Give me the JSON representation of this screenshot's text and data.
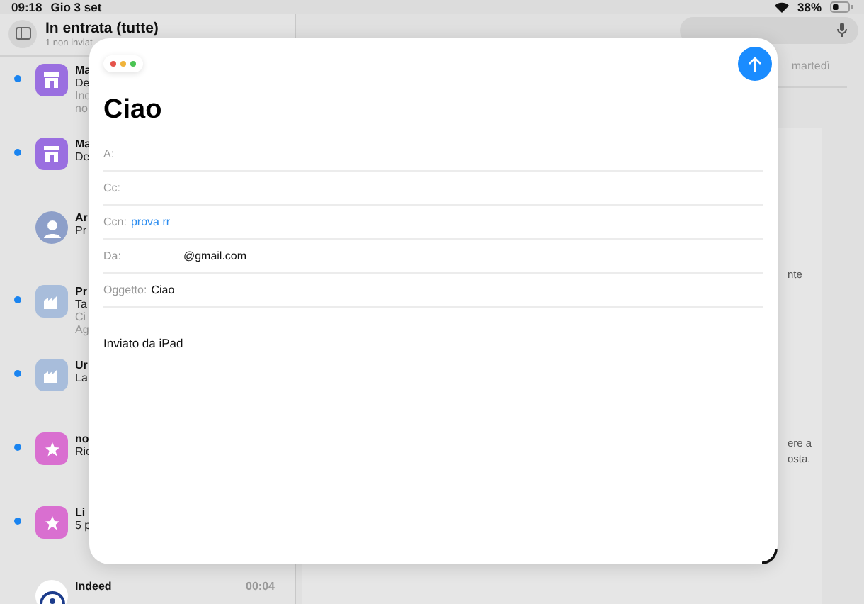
{
  "status_bar": {
    "time": "09:18",
    "date": "Gio 3 set",
    "battery": "38%"
  },
  "mailbox": {
    "title": "In entrata (tutte)",
    "subtitle": "1 non inviat"
  },
  "messages": [
    {
      "kind": "store",
      "unread": true,
      "lines": [
        "Ma",
        "De",
        "Inc",
        "no"
      ]
    },
    {
      "kind": "store",
      "unread": true,
      "lines": [
        "Ma",
        "De"
      ]
    },
    {
      "kind": "person",
      "unread": false,
      "lines": [
        "Ar",
        "Pr"
      ]
    },
    {
      "kind": "building",
      "unread": true,
      "lines": [
        "Pr",
        "Ta",
        "Ci",
        "Ag"
      ]
    },
    {
      "kind": "building",
      "unread": true,
      "lines": [
        "Ur",
        "La"
      ]
    },
    {
      "kind": "star",
      "unread": true,
      "lines": [
        "no",
        "Rie"
      ]
    },
    {
      "kind": "star",
      "unread": true,
      "lines": [
        "Li",
        "5 p"
      ]
    },
    {
      "kind": "logo",
      "unread": false,
      "lines": [
        "Indeed"
      ],
      "time": "00:04"
    }
  ],
  "reader": {
    "date": "martedì",
    "fragments": [
      "nte",
      "ere a",
      "osta."
    ]
  },
  "compose": {
    "title": "Ciao",
    "fields": [
      {
        "label": "A:"
      },
      {
        "label": "Cc:"
      },
      {
        "label": "Ccn:",
        "value": "prova rr",
        "kind": "recipient"
      },
      {
        "label": "Da:",
        "value": "@gmail.com",
        "kind": "account"
      },
      {
        "label": "Oggetto:",
        "value": "Ciao",
        "kind": "text"
      }
    ],
    "body": "Inviato da iPad"
  }
}
